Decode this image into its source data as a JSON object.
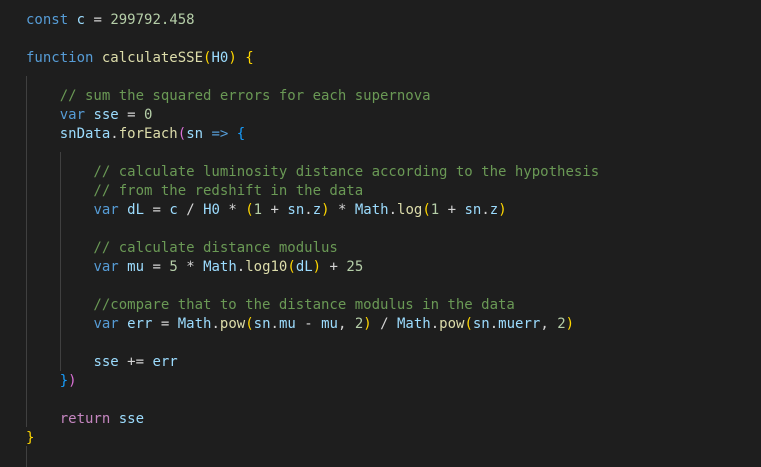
{
  "editor": {
    "colors": {
      "background": "#1e1e1e",
      "keyword": "#569cd6",
      "variable": "#9cdcfe",
      "function": "#dcdcaa",
      "number": "#b5cea8",
      "comment": "#6a9955",
      "operator": "#d4d4d4",
      "control": "#c586c0",
      "bracket_level_1": "#ffd700",
      "bracket_level_2": "#da70d6",
      "bracket_level_3": "#179fff"
    },
    "lines": [
      [
        {
          "t": "const",
          "c": "kw"
        },
        {
          "t": " c",
          "c": "var"
        },
        {
          "t": " = ",
          "c": "op"
        },
        {
          "t": "299792.458",
          "c": "num"
        }
      ],
      [],
      [
        {
          "t": "function",
          "c": "kw"
        },
        {
          "t": " ",
          "c": "op"
        },
        {
          "t": "calculateSSE",
          "c": "fn"
        },
        {
          "t": "(",
          "c": "b1"
        },
        {
          "t": "H0",
          "c": "var"
        },
        {
          "t": ")",
          "c": "b1"
        },
        {
          "t": " ",
          "c": "op"
        },
        {
          "t": "{",
          "c": "b1"
        }
      ],
      [],
      [
        {
          "t": "    // sum the squared errors for each supernova",
          "c": "cmt"
        }
      ],
      [
        {
          "t": "    ",
          "c": "op"
        },
        {
          "t": "var",
          "c": "kw"
        },
        {
          "t": " sse",
          "c": "var"
        },
        {
          "t": " = ",
          "c": "op"
        },
        {
          "t": "0",
          "c": "num"
        }
      ],
      [
        {
          "t": "    ",
          "c": "op"
        },
        {
          "t": "snData",
          "c": "var"
        },
        {
          "t": ".",
          "c": "op"
        },
        {
          "t": "forEach",
          "c": "fn"
        },
        {
          "t": "(",
          "c": "b2"
        },
        {
          "t": "sn",
          "c": "var"
        },
        {
          "t": " ",
          "c": "op"
        },
        {
          "t": "=>",
          "c": "kw"
        },
        {
          "t": " ",
          "c": "op"
        },
        {
          "t": "{",
          "c": "b3"
        }
      ],
      [],
      [
        {
          "t": "        // calculate luminosity distance according to the hypothesis",
          "c": "cmt"
        }
      ],
      [
        {
          "t": "        // from the redshift in the data",
          "c": "cmt"
        }
      ],
      [
        {
          "t": "        ",
          "c": "op"
        },
        {
          "t": "var",
          "c": "kw"
        },
        {
          "t": " dL",
          "c": "var"
        },
        {
          "t": " = ",
          "c": "op"
        },
        {
          "t": "c",
          "c": "var"
        },
        {
          "t": " / ",
          "c": "op"
        },
        {
          "t": "H0",
          "c": "var"
        },
        {
          "t": " * ",
          "c": "op"
        },
        {
          "t": "(",
          "c": "b1"
        },
        {
          "t": "1",
          "c": "num"
        },
        {
          "t": " + ",
          "c": "op"
        },
        {
          "t": "sn",
          "c": "var"
        },
        {
          "t": ".",
          "c": "op"
        },
        {
          "t": "z",
          "c": "var"
        },
        {
          "t": ")",
          "c": "b1"
        },
        {
          "t": " * ",
          "c": "op"
        },
        {
          "t": "Math",
          "c": "var"
        },
        {
          "t": ".",
          "c": "op"
        },
        {
          "t": "log",
          "c": "fn"
        },
        {
          "t": "(",
          "c": "b1"
        },
        {
          "t": "1",
          "c": "num"
        },
        {
          "t": " + ",
          "c": "op"
        },
        {
          "t": "sn",
          "c": "var"
        },
        {
          "t": ".",
          "c": "op"
        },
        {
          "t": "z",
          "c": "var"
        },
        {
          "t": ")",
          "c": "b1"
        }
      ],
      [],
      [
        {
          "t": "        // calculate distance modulus",
          "c": "cmt"
        }
      ],
      [
        {
          "t": "        ",
          "c": "op"
        },
        {
          "t": "var",
          "c": "kw"
        },
        {
          "t": " mu",
          "c": "var"
        },
        {
          "t": " = ",
          "c": "op"
        },
        {
          "t": "5",
          "c": "num"
        },
        {
          "t": " * ",
          "c": "op"
        },
        {
          "t": "Math",
          "c": "var"
        },
        {
          "t": ".",
          "c": "op"
        },
        {
          "t": "log10",
          "c": "fn"
        },
        {
          "t": "(",
          "c": "b1"
        },
        {
          "t": "dL",
          "c": "var"
        },
        {
          "t": ")",
          "c": "b1"
        },
        {
          "t": " + ",
          "c": "op"
        },
        {
          "t": "25",
          "c": "num"
        }
      ],
      [],
      [
        {
          "t": "        //compare that to the distance modulus in the data",
          "c": "cmt"
        }
      ],
      [
        {
          "t": "        ",
          "c": "op"
        },
        {
          "t": "var",
          "c": "kw"
        },
        {
          "t": " err",
          "c": "var"
        },
        {
          "t": " = ",
          "c": "op"
        },
        {
          "t": "Math",
          "c": "var"
        },
        {
          "t": ".",
          "c": "op"
        },
        {
          "t": "pow",
          "c": "fn"
        },
        {
          "t": "(",
          "c": "b1"
        },
        {
          "t": "sn",
          "c": "var"
        },
        {
          "t": ".",
          "c": "op"
        },
        {
          "t": "mu",
          "c": "var"
        },
        {
          "t": " - ",
          "c": "op"
        },
        {
          "t": "mu",
          "c": "var"
        },
        {
          "t": ", ",
          "c": "op"
        },
        {
          "t": "2",
          "c": "num"
        },
        {
          "t": ")",
          "c": "b1"
        },
        {
          "t": " / ",
          "c": "op"
        },
        {
          "t": "Math",
          "c": "var"
        },
        {
          "t": ".",
          "c": "op"
        },
        {
          "t": "pow",
          "c": "fn"
        },
        {
          "t": "(",
          "c": "b1"
        },
        {
          "t": "sn",
          "c": "var"
        },
        {
          "t": ".",
          "c": "op"
        },
        {
          "t": "muerr",
          "c": "var"
        },
        {
          "t": ", ",
          "c": "op"
        },
        {
          "t": "2",
          "c": "num"
        },
        {
          "t": ")",
          "c": "b1"
        }
      ],
      [],
      [
        {
          "t": "        ",
          "c": "op"
        },
        {
          "t": "sse",
          "c": "var"
        },
        {
          "t": " += ",
          "c": "op"
        },
        {
          "t": "err",
          "c": "var"
        }
      ],
      [
        {
          "t": "    ",
          "c": "op"
        },
        {
          "t": "}",
          "c": "b3"
        },
        {
          "t": ")",
          "c": "b2"
        }
      ],
      [],
      [
        {
          "t": "    ",
          "c": "op"
        },
        {
          "t": "return",
          "c": "flow"
        },
        {
          "t": " sse",
          "c": "var"
        }
      ],
      [
        {
          "t": "}",
          "c": "b1"
        }
      ],
      []
    ]
  }
}
